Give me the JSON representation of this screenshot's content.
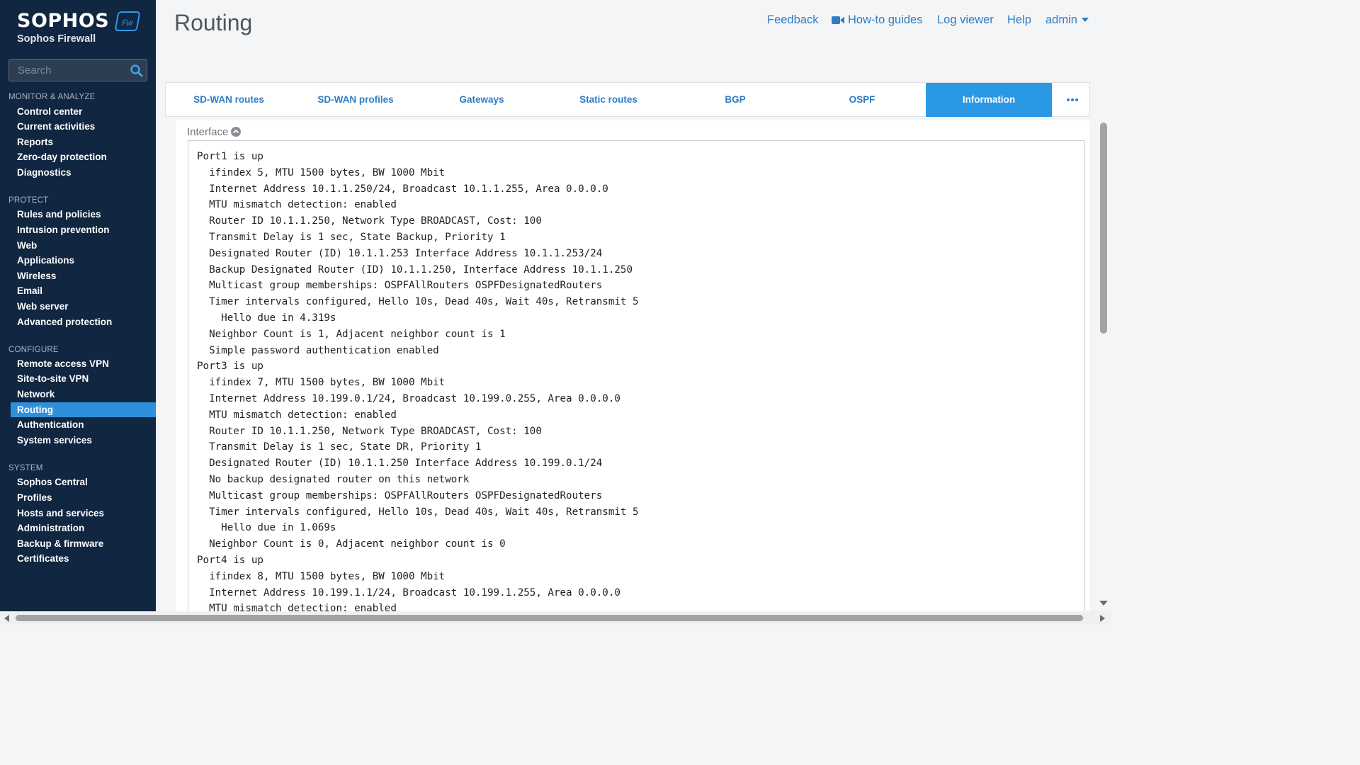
{
  "brand": {
    "logo_text": "SOPHOS",
    "product": "Sophos Firewall",
    "badge": "Fw"
  },
  "search": {
    "placeholder": "Search"
  },
  "sidebar": {
    "sections": [
      {
        "label": "MONITOR & ANALYZE",
        "items": [
          "Control center",
          "Current activities",
          "Reports",
          "Zero-day protection",
          "Diagnostics"
        ]
      },
      {
        "label": "PROTECT",
        "items": [
          "Rules and policies",
          "Intrusion prevention",
          "Web",
          "Applications",
          "Wireless",
          "Email",
          "Web server",
          "Advanced protection"
        ]
      },
      {
        "label": "CONFIGURE",
        "items": [
          "Remote access VPN",
          "Site-to-site VPN",
          "Network",
          "Routing",
          "Authentication",
          "System services"
        ]
      },
      {
        "label": "SYSTEM",
        "items": [
          "Sophos Central",
          "Profiles",
          "Hosts and services",
          "Administration",
          "Backup & firmware",
          "Certificates"
        ]
      }
    ],
    "active_item": "Routing"
  },
  "header": {
    "title": "Routing",
    "links": {
      "feedback": "Feedback",
      "howto": "How-to guides",
      "logviewer": "Log viewer",
      "help": "Help",
      "user": "admin"
    }
  },
  "tabs": [
    {
      "label": "SD-WAN routes",
      "active": false
    },
    {
      "label": "SD-WAN profiles",
      "active": false
    },
    {
      "label": "Gateways",
      "active": false
    },
    {
      "label": "Static routes",
      "active": false
    },
    {
      "label": "BGP",
      "active": false
    },
    {
      "label": "OSPF",
      "active": false
    },
    {
      "label": "Information",
      "active": true
    }
  ],
  "section": {
    "title": "Interface"
  },
  "output_lines": [
    "Port1 is up",
    "  ifindex 5, MTU 1500 bytes, BW 1000 Mbit",
    "  Internet Address 10.1.1.250/24, Broadcast 10.1.1.255, Area 0.0.0.0",
    "  MTU mismatch detection: enabled",
    "  Router ID 10.1.1.250, Network Type BROADCAST, Cost: 100",
    "  Transmit Delay is 1 sec, State Backup, Priority 1",
    "  Designated Router (ID) 10.1.1.253 Interface Address 10.1.1.253/24",
    "  Backup Designated Router (ID) 10.1.1.250, Interface Address 10.1.1.250",
    "  Multicast group memberships: OSPFAllRouters OSPFDesignatedRouters",
    "  Timer intervals configured, Hello 10s, Dead 40s, Wait 40s, Retransmit 5",
    "    Hello due in 4.319s",
    "  Neighbor Count is 1, Adjacent neighbor count is 1",
    "  Simple password authentication enabled",
    "Port3 is up",
    "  ifindex 7, MTU 1500 bytes, BW 1000 Mbit",
    "  Internet Address 10.199.0.1/24, Broadcast 10.199.0.255, Area 0.0.0.0",
    "  MTU mismatch detection: enabled",
    "  Router ID 10.1.1.250, Network Type BROADCAST, Cost: 100",
    "  Transmit Delay is 1 sec, State DR, Priority 1",
    "  Designated Router (ID) 10.1.1.250 Interface Address 10.199.0.1/24",
    "  No backup designated router on this network",
    "  Multicast group memberships: OSPFAllRouters OSPFDesignatedRouters",
    "  Timer intervals configured, Hello 10s, Dead 40s, Wait 40s, Retransmit 5",
    "    Hello due in 1.069s",
    "  Neighbor Count is 0, Adjacent neighbor count is 0",
    "Port4 is up",
    "  ifindex 8, MTU 1500 bytes, BW 1000 Mbit",
    "  Internet Address 10.199.1.1/24, Broadcast 10.199.1.255, Area 0.0.0.0",
    "  MTU mismatch detection: enabled"
  ],
  "colors": {
    "sidebar_bg": "#102641",
    "accent": "#2b98e5",
    "link": "#2f7dc4"
  }
}
